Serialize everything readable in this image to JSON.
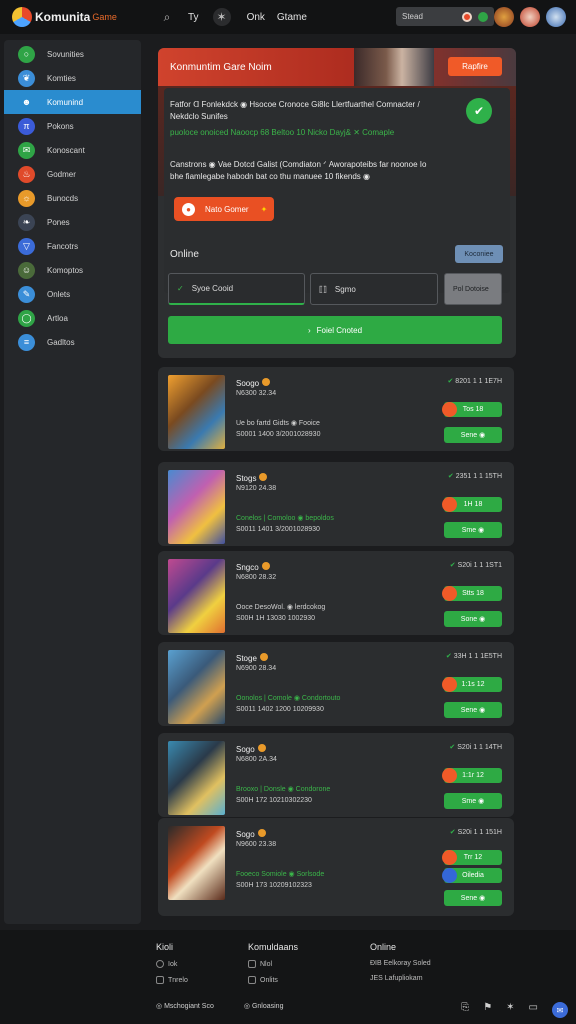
{
  "topbar": {
    "logo_text": "Komunita",
    "logo_sub": "Game",
    "nav": [
      "Ty",
      "Onk",
      "Gtame"
    ],
    "search_placeholder": "Stead",
    "search_value": "8"
  },
  "sidebar": {
    "items": [
      {
        "label": "Sovunities",
        "color": "#2fa446",
        "icon": "circle-icon"
      },
      {
        "label": "Komties",
        "color": "#3b8ed8",
        "icon": "bird-icon"
      },
      {
        "label": "Komunind",
        "color": "#2a8ccf",
        "icon": "avatar-icon",
        "active": true
      },
      {
        "label": "Pokons",
        "color": "#3b5bd8",
        "icon": "pi-icon"
      },
      {
        "label": "Konoscant",
        "color": "#2fa446",
        "icon": "chat-icon"
      },
      {
        "label": "Godmer",
        "color": "#e04a2a",
        "icon": "flame-icon"
      },
      {
        "label": "Bunocds",
        "color": "#e89a2a",
        "icon": "sun-icon"
      },
      {
        "label": "Pones",
        "color": "#3b4454",
        "icon": "leaf-icon"
      },
      {
        "label": "Fancotrs",
        "color": "#3b6bd8",
        "icon": "triangle-icon"
      },
      {
        "label": "Komoptos",
        "color": "#4a6a3a",
        "icon": "person-icon"
      },
      {
        "label": "Onlets",
        "color": "#3b8ed8",
        "icon": "pencil-icon"
      },
      {
        "label": "Artloa",
        "color": "#2fa446",
        "icon": "ring-icon"
      },
      {
        "label": "Gadltos",
        "color": "#3b8ed8",
        "icon": "lines-icon"
      }
    ]
  },
  "hero": {
    "title": "Konmuntim Gare Noim",
    "banner_button": "Rapfire",
    "line1": "Fatfor ᗡ Fonlekdck  ◉ Hsocoe Cronoce Gi8lc Llertfuarthel Comnacter /",
    "line2": "Nekdclo Sunifes",
    "line3": "puoloce onoiced Naoocp 68 Beltoo 10 Nicko Dayj& ✕ Comaple",
    "line4": "Canstrons  ◉ Vae Dotcd Galist (Comdiaton  ᐟ Aworapoteibs far noonoe Io",
    "line5": "bhe fiamlegabe habodn bat co thu manuee 10 fikends ◉",
    "cta": "Nato Gomer",
    "online_label": "Online",
    "online_button": "Koconiee",
    "field_a": "Syoe Cooid",
    "field_b": "Sgmo",
    "field_c": "Pol Dotoise",
    "primary_button": "Foiel Cnoted"
  },
  "games": [
    {
      "title": "Soogo",
      "sub": "N6300 32.34",
      "desc": "Ue bo fartd Gidts  ◉ Fooice",
      "desc_green": false,
      "id": "S0001 1400 3/2001028930",
      "stat": "8201 1 1 1E7H",
      "pill": "Tos 18",
      "pill_blue": false,
      "save": "Sene ◉"
    },
    {
      "title": "Stogs",
      "sub": "N9120 24.38",
      "desc": "Conelos | Comoloo  ◉ bepoldos",
      "desc_green": true,
      "id": "S0011 1401 3/2001028930",
      "stat": "2351 1 1 15TH",
      "pill": "1H 18",
      "pill_blue": false,
      "save": "Sme ◉"
    },
    {
      "title": "Sngco",
      "sub": "N6800 28.32",
      "desc": "Ooce DesoWol.  ◉ lerdcokog",
      "desc_green": false,
      "id": "S00H 1H 13030 1002930",
      "stat": "S20i 1 1 1ST1",
      "pill": "Stts 18",
      "pill_blue": false,
      "save": "Sone ◉"
    },
    {
      "title": "Stoge",
      "sub": "N6900 28.34",
      "desc": "Oonolos | Comole  ◉ Condortouto",
      "desc_green": true,
      "id": "S0011 1402 1200 10209930",
      "stat": "33H 1 1 1E5TH",
      "pill": "1:1s 12",
      "pill_blue": false,
      "save": "Sene ◉"
    },
    {
      "title": "Sogo",
      "sub": "N6800 2A.34",
      "desc": "Brooxo | Donsle  ◉ Condorone",
      "desc_green": true,
      "id": "S00H 172 10210302230",
      "stat": "S20i 1 1 14TH",
      "pill": "1:1r 12",
      "pill_blue": false,
      "save": "Sme ◉"
    },
    {
      "title": "Sogo",
      "sub": "N9600 23.38",
      "desc": "Fooeco Somiole  ◉ Sorlsode",
      "desc_green": true,
      "id": "S00H 173 10209102323",
      "stat": "S20i 1 1 151H",
      "pill": "Trr 12",
      "pill_blue": false,
      "pill2": "Oiledia",
      "save": "Sene ◉"
    }
  ],
  "footer": {
    "col1_title": "Kioli",
    "col1_items": [
      "Iok",
      "Tnrelo"
    ],
    "col2_title": "Komuldaans",
    "col2_items": [
      "Nlol",
      "Onlits"
    ],
    "col3_title": "Online",
    "col3_items": [
      "ÐIB Eelkoray Soled",
      "JES Lafupliokam"
    ],
    "bottom": [
      "Mschogiant Sco",
      "Gnloasing"
    ]
  }
}
